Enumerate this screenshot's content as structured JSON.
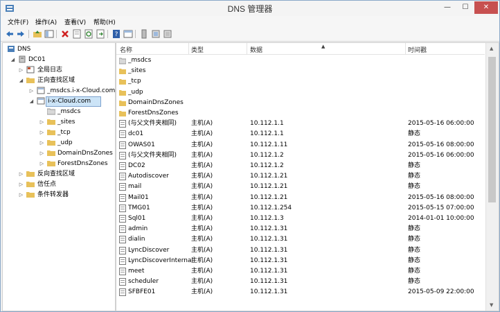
{
  "window": {
    "title": "DNS 管理器",
    "minimize": "—",
    "maximize": "☐",
    "close": "✕"
  },
  "menu": [
    "文件(F)",
    "操作(A)",
    "查看(V)",
    "帮助(H)"
  ],
  "toolbar": [
    "back-icon",
    "forward-icon",
    "up-folder-icon",
    "show-tree-icon",
    "delete-icon",
    "properties-icon",
    "refresh-icon",
    "export-icon",
    "help-icon",
    "view-icon",
    "server-icon",
    "record-icon",
    "record2-icon"
  ],
  "tree": {
    "root": "DNS",
    "server": "DC01",
    "global_logs": "全局日志",
    "forward_zones": "正向查找区域",
    "zone_msdcs": "_msdcs.i-x-Cloud.com",
    "zone_selected": "i-x-Cloud.com",
    "sub_msdcs": "_msdcs",
    "sub_sites": "_sites",
    "sub_tcp": "_tcp",
    "sub_udp": "_udp",
    "sub_domaindns": "DomainDnsZones",
    "sub_forestdns": "ForestDnsZones",
    "reverse_zones": "反向查找区域",
    "trust_points": "信任点",
    "conditional_forwarders": "条件转发器"
  },
  "columns": {
    "name": "名称",
    "type": "类型",
    "data": "数据",
    "timestamp": "时间戳"
  },
  "records": [
    {
      "icon": "folder-icon",
      "name": "_msdcs",
      "type": "",
      "data": "",
      "time": ""
    },
    {
      "icon": "folder-icon",
      "name": "_sites",
      "type": "",
      "data": "",
      "time": ""
    },
    {
      "icon": "folder-icon",
      "name": "_tcp",
      "type": "",
      "data": "",
      "time": ""
    },
    {
      "icon": "folder-icon",
      "name": "_udp",
      "type": "",
      "data": "",
      "time": ""
    },
    {
      "icon": "folder-icon",
      "name": "DomainDnsZones",
      "type": "",
      "data": "",
      "time": ""
    },
    {
      "icon": "folder-icon",
      "name": "ForestDnsZones",
      "type": "",
      "data": "",
      "time": ""
    },
    {
      "icon": "record-icon",
      "name": "(与父文件夹相同)",
      "type": "主机(A)",
      "data": "10.112.1.1",
      "time": "2015-05-16 06:00:00"
    },
    {
      "icon": "record-icon",
      "name": "dc01",
      "type": "主机(A)",
      "data": "10.112.1.1",
      "time": "静态"
    },
    {
      "icon": "record-icon",
      "name": "OWAS01",
      "type": "主机(A)",
      "data": "10.112.1.11",
      "time": "2015-05-16 08:00:00"
    },
    {
      "icon": "record-icon",
      "name": "(与父文件夹相同)",
      "type": "主机(A)",
      "data": "10.112.1.2",
      "time": "2015-05-16 06:00:00"
    },
    {
      "icon": "record-icon",
      "name": "DC02",
      "type": "主机(A)",
      "data": "10.112.1.2",
      "time": "静态"
    },
    {
      "icon": "record-icon",
      "name": "Autodiscover",
      "type": "主机(A)",
      "data": "10.112.1.21",
      "time": "静态"
    },
    {
      "icon": "record-icon",
      "name": "mail",
      "type": "主机(A)",
      "data": "10.112.1.21",
      "time": "静态"
    },
    {
      "icon": "record-icon",
      "name": "Mail01",
      "type": "主机(A)",
      "data": "10.112.1.21",
      "time": "2015-05-16 08:00:00"
    },
    {
      "icon": "record-icon",
      "name": "TMG01",
      "type": "主机(A)",
      "data": "10.112.1.254",
      "time": "2015-05-15 07:00:00"
    },
    {
      "icon": "record-icon",
      "name": "Sql01",
      "type": "主机(A)",
      "data": "10.112.1.3",
      "time": "2014-01-01 10:00:00"
    },
    {
      "icon": "record-icon",
      "name": "admin",
      "type": "主机(A)",
      "data": "10.112.1.31",
      "time": "静态"
    },
    {
      "icon": "record-icon",
      "name": "dialin",
      "type": "主机(A)",
      "data": "10.112.1.31",
      "time": "静态"
    },
    {
      "icon": "record-icon",
      "name": "LyncDiscover",
      "type": "主机(A)",
      "data": "10.112.1.31",
      "time": "静态"
    },
    {
      "icon": "record-icon",
      "name": "LyncDiscoverInternal",
      "type": "主机(A)",
      "data": "10.112.1.31",
      "time": "静态"
    },
    {
      "icon": "record-icon",
      "name": "meet",
      "type": "主机(A)",
      "data": "10.112.1.31",
      "time": "静态"
    },
    {
      "icon": "record-icon",
      "name": "scheduler",
      "type": "主机(A)",
      "data": "10.112.1.31",
      "time": "静态"
    },
    {
      "icon": "record-icon",
      "name": "SFBFE01",
      "type": "主机(A)",
      "data": "10.112.1.31",
      "time": "2015-05-09 22:00:00"
    }
  ],
  "colors": {
    "selection": "#cce4f7",
    "selection_border": "#7da2ce",
    "folder": "#e8c15a",
    "close_button": "#c75050"
  }
}
